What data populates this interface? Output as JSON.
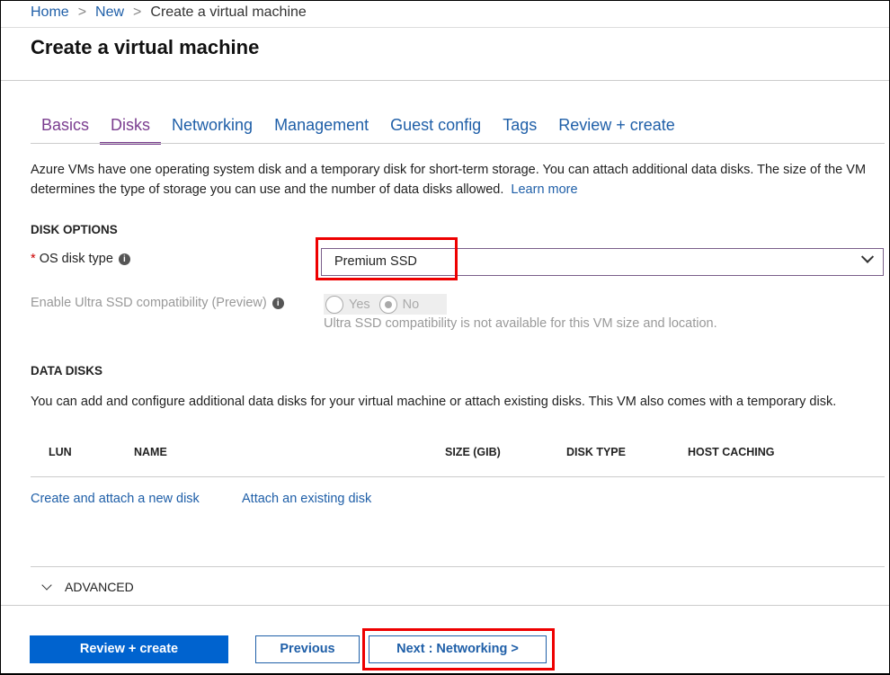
{
  "breadcrumb": {
    "items": [
      "Home",
      "New"
    ],
    "current": "Create a virtual machine"
  },
  "title": "Create a virtual machine",
  "tabs": [
    "Basics",
    "Disks",
    "Networking",
    "Management",
    "Guest config",
    "Tags",
    "Review + create"
  ],
  "active_tab": "Disks",
  "description": {
    "text": "Azure VMs have one operating system disk and a temporary disk for short-term storage. You can attach additional data disks. The size of the VM determines the type of storage you can use and the number of data disks allowed.",
    "learn_more": "Learn more"
  },
  "disk_options": {
    "heading": "DISK OPTIONS",
    "os_disk_label": "OS disk type",
    "required_mark": "*",
    "os_disk_value": "Premium SSD",
    "ultra_label": "Enable Ultra SSD compatibility (Preview)",
    "ultra_options": [
      "Yes",
      "No"
    ],
    "ultra_selected": "No",
    "ultra_note": "Ultra SSD compatibility is not available for this VM size and location."
  },
  "data_disks": {
    "heading": "DATA DISKS",
    "text": "You can add and configure additional data disks for your virtual machine or attach existing disks. This VM also comes with a temporary disk.",
    "columns": [
      "LUN",
      "NAME",
      "SIZE (GIB)",
      "DISK TYPE",
      "HOST CACHING"
    ],
    "create_link": "Create and attach a new disk",
    "attach_link": "Attach an existing disk"
  },
  "advanced": "ADVANCED",
  "footer": {
    "review": "Review + create",
    "previous": "Previous",
    "next": "Next : Networking >"
  },
  "colors": {
    "accent": "#0063cf",
    "link": "#1f5fa8",
    "active_tab": "#7a3d8f",
    "highlight": "#e00000"
  }
}
